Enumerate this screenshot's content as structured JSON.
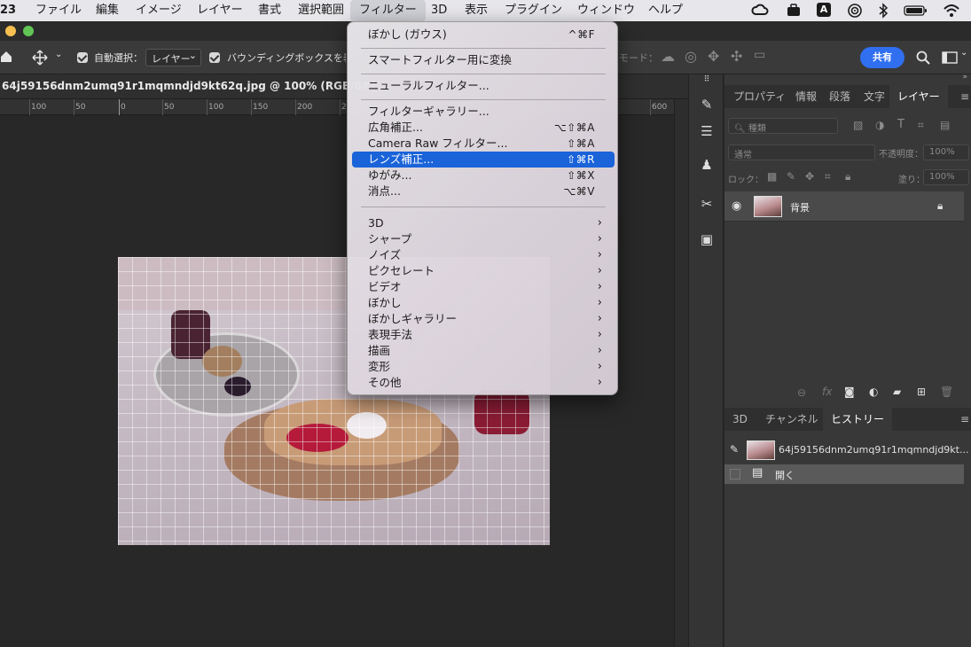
{
  "menubar": {
    "items": [
      "23",
      "ファイル",
      "編集",
      "イメージ",
      "レイヤー",
      "書式",
      "選択範囲",
      "フィルター",
      "3D",
      "表示",
      "プラグイン",
      "ウィンドウ",
      "ヘルプ"
    ],
    "active": "フィルター",
    "status_icons": [
      "creative-cloud-icon",
      "briefcase-icon",
      "input-source-icon",
      "airdrop-icon",
      "bluetooth-icon",
      "battery-icon",
      "wifi-icon"
    ],
    "input_source_letter": "A"
  },
  "options_bar": {
    "auto_select_label": "自動選択：",
    "auto_select_value": "レイヤー",
    "bounding_box_label": "バウンディングボックスを表示",
    "mode_label": "モード：",
    "share_label": "共有"
  },
  "document": {
    "tab_title": "64j59156dnm2umq91r1mqmndjd9kt62q.jpg @ 100% (RGB/8#)",
    "ruler_ticks": [
      "100",
      "50",
      "0",
      "50",
      "100",
      "150",
      "200",
      "2",
      "600"
    ]
  },
  "filter_menu": {
    "items": [
      {
        "label": "ぼかし (ガウス)",
        "shortcut": "^⌘F"
      },
      {
        "label": "スマートフィルター用に変換",
        "shortcut": ""
      },
      {
        "label": "ニューラルフィルター...",
        "shortcut": ""
      },
      {
        "label": "フィルターギャラリー...",
        "shortcut": ""
      },
      {
        "label": "広角補正...",
        "shortcut": "⌥⇧⌘A"
      },
      {
        "label": "Camera Raw フィルター...",
        "shortcut": "⇧⌘A"
      },
      {
        "label": "レンズ補正...",
        "shortcut": "⇧⌘R"
      },
      {
        "label": "ゆがみ...",
        "shortcut": "⇧⌘X"
      },
      {
        "label": "消点...",
        "shortcut": "⌥⌘V"
      },
      {
        "label": "3D",
        "shortcut": ""
      },
      {
        "label": "シャープ",
        "shortcut": ""
      },
      {
        "label": "ノイズ",
        "shortcut": ""
      },
      {
        "label": "ピクセレート",
        "shortcut": ""
      },
      {
        "label": "ビデオ",
        "shortcut": ""
      },
      {
        "label": "ぼかし",
        "shortcut": ""
      },
      {
        "label": "ぼかしギャラリー",
        "shortcut": ""
      },
      {
        "label": "表現手法",
        "shortcut": ""
      },
      {
        "label": "描画",
        "shortcut": ""
      },
      {
        "label": "変形",
        "shortcut": ""
      },
      {
        "label": "その他",
        "shortcut": ""
      }
    ],
    "highlighted": "レンズ補正...",
    "submenu_arrow": "›"
  },
  "panels": {
    "top_tabs": [
      "プロパティ",
      "情報",
      "段落",
      "文字",
      "レイヤー"
    ],
    "active_top_tab": "レイヤー",
    "layer_filter_placeholder": "種類",
    "blend_mode": "通常",
    "opacity_label": "不透明度：",
    "opacity_value": "100%",
    "lock_label": "ロック：",
    "fill_label": "塗り：",
    "fill_value": "100%",
    "layer_name": "背景",
    "bottom_tabs": [
      "3D",
      "チャンネル",
      "ヒストリー"
    ],
    "active_bottom_tab": "ヒストリー",
    "history_snapshot": "64j59156dnm2umq91r1mqmndjd9kt...",
    "history_step": "開く"
  },
  "colors": {
    "accent_blue": "#1a63d9",
    "share_blue": "#2f6ff0"
  }
}
